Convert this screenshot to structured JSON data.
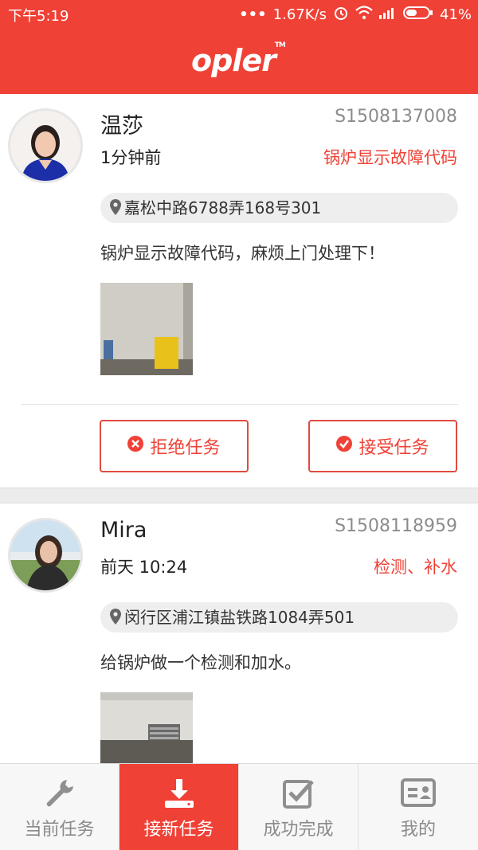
{
  "status_bar": {
    "time": "下午5:19",
    "net_speed": "1.67K/s",
    "battery": "41%"
  },
  "app": {
    "logo": "opler",
    "logo_tm": "TM"
  },
  "tasks": [
    {
      "customer": "温莎",
      "order_no": "S1508137008",
      "time": "1分钟前",
      "issue": "锅炉显示故障代码",
      "address": "嘉松中路6788弄168号301",
      "description": "锅炉显示故障代码，麻烦上门处理下！",
      "reject_label": "拒绝任务",
      "accept_label": "接受任务"
    },
    {
      "customer": "Mira",
      "order_no": "S1508118959",
      "time": "前天 10:24",
      "issue": "检测、补水",
      "address": "闵行区浦江镇盐铁路1084弄501",
      "description": "给锅炉做一个检测和加水。"
    }
  ],
  "tabs": [
    {
      "label": "当前任务",
      "icon": "wrench-icon",
      "active": false
    },
    {
      "label": "接新任务",
      "icon": "download-icon",
      "active": true
    },
    {
      "label": "成功完成",
      "icon": "checkbox-icon",
      "active": false
    },
    {
      "label": "我的",
      "icon": "id-card-icon",
      "active": false
    }
  ],
  "colors": {
    "brand": "#ef4136",
    "muted": "#8a8a8a"
  }
}
